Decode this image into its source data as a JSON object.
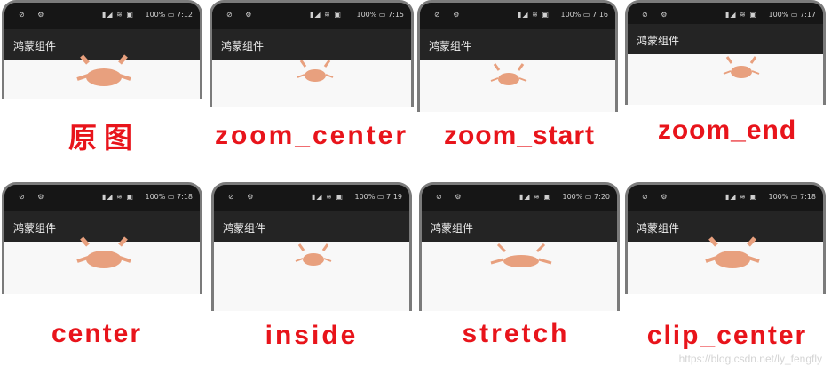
{
  "panels": [
    {
      "title": "鸿蒙组件",
      "time": "7:12",
      "battery": "100%",
      "caption": "原图"
    },
    {
      "title": "鸿蒙组件",
      "time": "7:15",
      "battery": "100%",
      "caption": "zoom_center"
    },
    {
      "title": "鸿蒙组件",
      "time": "7:16",
      "battery": "100%",
      "caption": "zoom_start"
    },
    {
      "title": "鸿蒙组件",
      "time": "7:17",
      "battery": "100%",
      "caption": "zoom_end"
    },
    {
      "title": "鸿蒙组件",
      "time": "7:18",
      "battery": "100%",
      "caption": "center"
    },
    {
      "title": "鸿蒙组件",
      "time": "7:19",
      "battery": "100%",
      "caption": "inside"
    },
    {
      "title": "鸿蒙组件",
      "time": "7:20",
      "battery": "100%",
      "caption": "stretch"
    },
    {
      "title": "鸿蒙组件",
      "time": "7:18",
      "battery": "100%",
      "caption": "clip_center"
    }
  ],
  "watermark": "https://blog.csdn.net/ly_fengfly",
  "colors": {
    "caption": "#e8141b",
    "appbar": "#242424",
    "content": "#f8f8f8"
  }
}
